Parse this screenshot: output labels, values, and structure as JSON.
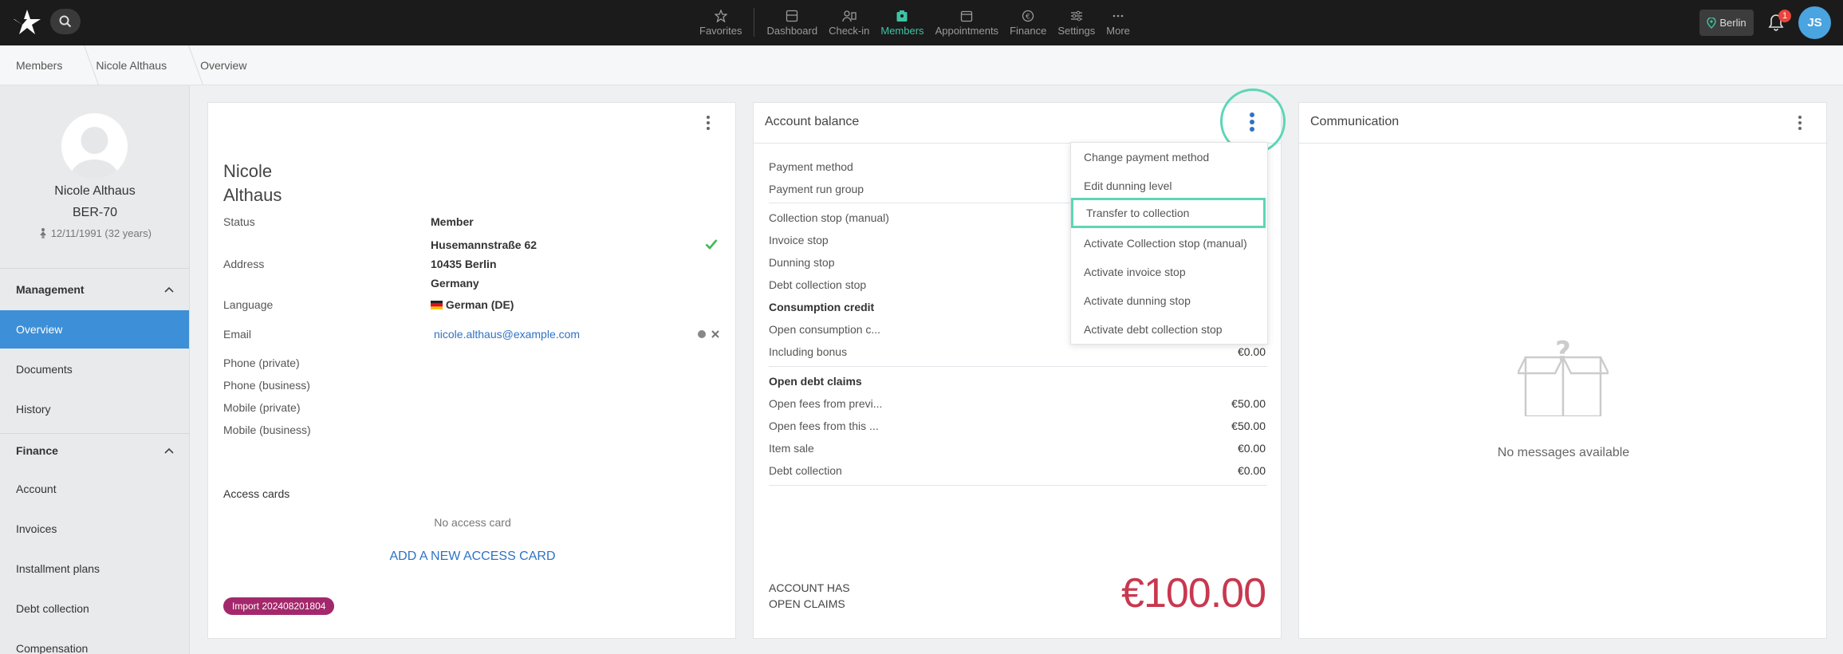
{
  "topbar": {
    "nav": [
      {
        "label": "Favorites",
        "icon": "star-icon"
      },
      {
        "label": "Dashboard",
        "icon": "dashboard-icon"
      },
      {
        "label": "Check-in",
        "icon": "checkin-icon"
      },
      {
        "label": "Members",
        "icon": "members-icon",
        "active": true
      },
      {
        "label": "Appointments",
        "icon": "calendar-icon"
      },
      {
        "label": "Finance",
        "icon": "euro-icon"
      },
      {
        "label": "Settings",
        "icon": "sliders-icon"
      },
      {
        "label": "More",
        "icon": "ellipsis-icon"
      }
    ],
    "location": "Berlin",
    "notifications": "1",
    "user_initials": "JS"
  },
  "breadcrumb": [
    "Members",
    "Nicole Althaus",
    "Overview"
  ],
  "sidebar": {
    "name": "Nicole Althaus",
    "member_id": "BER-70",
    "birth": "12/11/1991 (32 years)",
    "sections": [
      {
        "title": "Management",
        "items": [
          "Overview",
          "Documents",
          "History"
        ]
      },
      {
        "title": "Finance",
        "items": [
          "Account",
          "Invoices",
          "Installment plans",
          "Debt collection",
          "Compensation"
        ]
      }
    ]
  },
  "member_card": {
    "first_name": "Nicole",
    "last_name": "Althaus",
    "rows": {
      "status_label": "Status",
      "status_value": "Member",
      "address_label": "Address",
      "address_line1": "Husemannstraße 62",
      "address_line2": "10435 Berlin",
      "address_line3": "Germany",
      "language_label": "Language",
      "language_value": "German (DE)",
      "email_label": "Email",
      "email_value": "nicole.althaus@example.com",
      "phone_private": "Phone (private)",
      "phone_business": "Phone (business)",
      "mobile_private": "Mobile (private)",
      "mobile_business": "Mobile (business)"
    },
    "access_cards_title": "Access cards",
    "no_access_card": "No access card",
    "add_access_card": "ADD A NEW ACCESS CARD",
    "import_badge": "Import 202408201804"
  },
  "balance_card": {
    "title": "Account balance",
    "rows": [
      {
        "label": "Payment method"
      },
      {
        "label": "Payment run group"
      },
      {
        "label": "Collection stop (manual)"
      },
      {
        "label": "Invoice stop"
      },
      {
        "label": "Dunning stop"
      },
      {
        "label": "Debt collection stop"
      },
      {
        "label": "Consumption credit",
        "bold": true
      },
      {
        "label": "Open consumption c..."
      },
      {
        "label": "Including bonus",
        "value": "€0.00"
      },
      {
        "label": "Open debt claims",
        "bold": true
      },
      {
        "label": "Open fees from previ...",
        "value": "€50.00"
      },
      {
        "label": "Open fees from this ...",
        "value": "€50.00"
      },
      {
        "label": "Item sale",
        "value": "€0.00"
      },
      {
        "label": "Debt collection",
        "value": "€0.00"
      }
    ],
    "footer_line1": "ACCOUNT HAS",
    "footer_line2": "OPEN CLAIMS",
    "total": "€100.00",
    "total_color": "#c8384f",
    "menu": [
      "Change payment method",
      "Edit dunning level",
      "Transfer to collection",
      "Activate Collection stop (manual)",
      "Activate invoice stop",
      "Activate dunning stop",
      "Activate debt collection stop"
    ]
  },
  "communication_card": {
    "title": "Communication",
    "empty": "No messages available"
  },
  "colors": {
    "accent": "#3fc3a2",
    "highlight": "#5cd6b6",
    "link": "#2f72c4",
    "active_side": "#3d8fd7"
  }
}
